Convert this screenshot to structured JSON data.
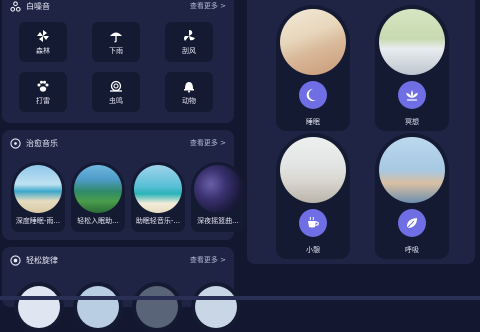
{
  "colors": {
    "background": "#131730",
    "panel": "#1f2445",
    "tile": "#151a33",
    "accent": "#6f6ee4"
  },
  "white_noise": {
    "title": "白噪音",
    "more": "查看更多 >",
    "items": [
      {
        "label": "森林",
        "icon": "pinwheel-icon"
      },
      {
        "label": "下雨",
        "icon": "umbrella-icon"
      },
      {
        "label": "刮风",
        "icon": "wind-icon"
      },
      {
        "label": "打雷",
        "icon": "paw-icon"
      },
      {
        "label": "虫鸣",
        "icon": "snail-icon"
      },
      {
        "label": "动物",
        "icon": "bell-icon"
      }
    ]
  },
  "healing_music": {
    "title": "治愈音乐",
    "more": "查看更多 >",
    "items": [
      {
        "label": "深度睡眠-雨..."
      },
      {
        "label": "轻松入眠助..."
      },
      {
        "label": "助眠轻音乐-..."
      },
      {
        "label": "深夜摇篮曲..."
      }
    ]
  },
  "relax_melody": {
    "title": "轻松旋律",
    "more": "查看更多 >"
  },
  "modes": [
    {
      "label": "睡眠",
      "icon": "moon-zzz-icon"
    },
    {
      "label": "冥想",
      "icon": "lotus-icon"
    },
    {
      "label": "小憩",
      "icon": "cup-icon"
    },
    {
      "label": "呼吸",
      "icon": "leaf-icon"
    }
  ]
}
